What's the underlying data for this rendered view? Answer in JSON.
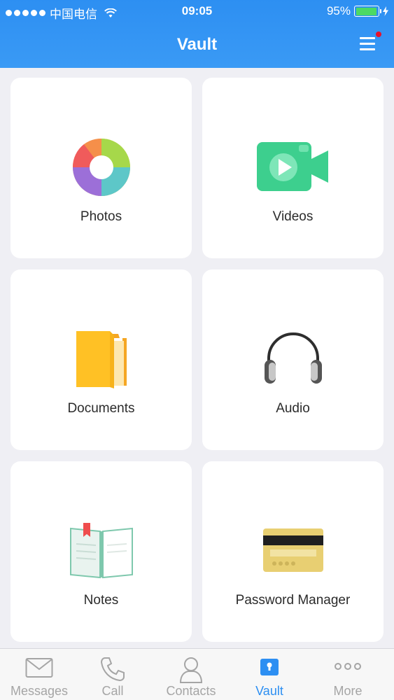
{
  "status_bar": {
    "carrier": "中国电信",
    "time": "09:05",
    "battery": "95%",
    "battery_level": 0.95
  },
  "header": {
    "title": "Vault",
    "menu_icon": "hamburger-menu-icon",
    "notification_dot_color": "#e8102a"
  },
  "grid": {
    "items": [
      {
        "label": "Photos",
        "icon": "photos-aperture-icon"
      },
      {
        "label": "Videos",
        "icon": "video-camera-icon"
      },
      {
        "label": "Documents",
        "icon": "folder-icon"
      },
      {
        "label": "Audio",
        "icon": "headphones-icon"
      },
      {
        "label": "Notes",
        "icon": "open-book-icon"
      },
      {
        "label": "Password Manager",
        "icon": "credit-card-icon"
      }
    ]
  },
  "tab_bar": {
    "tabs": [
      {
        "label": "Messages",
        "icon": "envelope-icon",
        "active": false
      },
      {
        "label": "Call",
        "icon": "phone-icon",
        "active": false
      },
      {
        "label": "Contacts",
        "icon": "person-icon",
        "active": false
      },
      {
        "label": "Vault",
        "icon": "lock-icon",
        "active": true
      },
      {
        "label": "More",
        "icon": "more-dots-icon",
        "active": false
      }
    ]
  },
  "colors": {
    "accent": "#2d8ff2",
    "background": "#efeff4",
    "inactive_tab": "#a5a5a5"
  }
}
